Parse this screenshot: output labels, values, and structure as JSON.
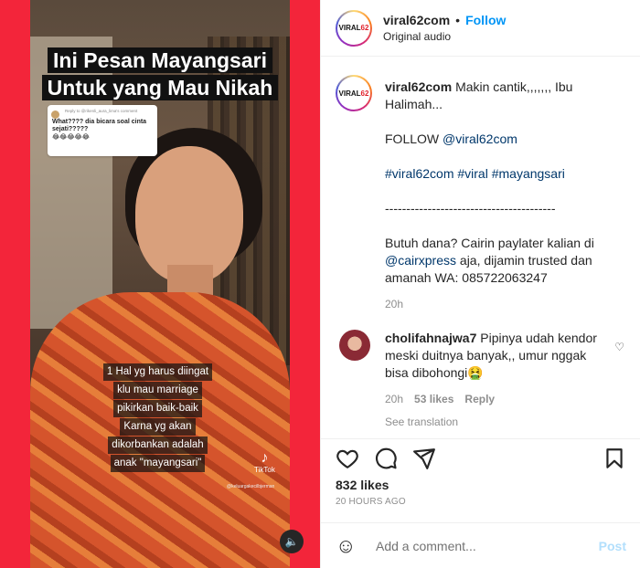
{
  "video": {
    "title_line1": "Ini Pesan Mayangsari",
    "title_line2": "Untuk yang Mau Nikah",
    "reply_meta": "Reply to @rikenli_aura_lima's comment",
    "reply_text": "What???? dia bicara soal cinta sejati?????",
    "reply_emojis": "😂😂😂😂😂",
    "caption_lines": [
      "1 Hal yg harus diingat",
      "klu mau marriage",
      "pikirkan baik-baik",
      "Karna yg akan",
      "dikorbankan adalah",
      "anak \"mayangsari\""
    ],
    "tiktok_label": "TikTok",
    "tiktok_user": "@keluargakecilbjerman"
  },
  "header": {
    "username": "viral62com",
    "follow_label": "Follow",
    "audio": "Original audio",
    "avatar_text": "VIRAL62"
  },
  "caption": {
    "username": "viral62com",
    "text": "Makin cantik,,,,,,, Ibu Halimah...",
    "follow_prefix": "FOLLOW",
    "follow_handle": "@viral62com",
    "hashtags": "#viral62com #viral #mayangsari",
    "separator": "----------------------------------------",
    "ad_text1": "Butuh dana? Cairin paylater kalian di",
    "ad_handle": "@cairxpress",
    "ad_text2": "aja, dijamin trusted dan amanah WA: 085722063247",
    "time": "20h"
  },
  "comment": {
    "username": "cholifahnajwa7",
    "text": "Pipinya udah kendor meski duitnya banyak,, umur nggak bisa dibohongi🤮",
    "time": "20h",
    "likes": "53 likes",
    "reply": "Reply",
    "see_translation": "See translation"
  },
  "actions": {
    "likes": "832 likes",
    "ago": "20 HOURS AGO"
  },
  "add_comment": {
    "placeholder": "Add a comment...",
    "post_label": "Post"
  },
  "colors": {
    "accent_blue": "#0095f6",
    "video_bg_red": "#f3253a",
    "post_disabled": "#b2dffc"
  }
}
